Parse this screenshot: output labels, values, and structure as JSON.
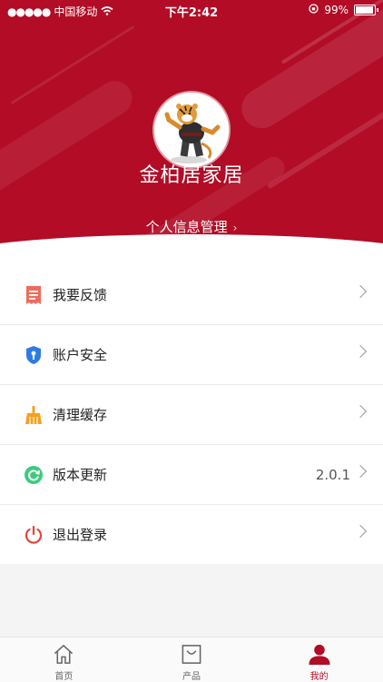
{
  "status_bar": {
    "carrier": "中国移动",
    "time": "下午2:42",
    "battery": "99%"
  },
  "profile": {
    "name": "金柏居家居",
    "info_link": "个人信息管理"
  },
  "menu": [
    {
      "label": "我要反馈",
      "value": "",
      "icon": "feedback-icon"
    },
    {
      "label": "账户安全",
      "value": "",
      "icon": "shield-lock-icon"
    },
    {
      "label": "清理缓存",
      "value": "",
      "icon": "broom-icon"
    },
    {
      "label": "版本更新",
      "value": "2.0.1",
      "icon": "refresh-icon"
    },
    {
      "label": "退出登录",
      "value": "",
      "icon": "power-icon"
    }
  ],
  "tabs": [
    {
      "label": "首页",
      "icon": "home-icon",
      "active": false
    },
    {
      "label": "产品",
      "icon": "shopping-bag-icon",
      "active": false
    },
    {
      "label": "我的",
      "icon": "user-icon",
      "active": true
    }
  ],
  "colors": {
    "brand": "#b20c26",
    "feedback": "#f06a5b",
    "security": "#2f7be5",
    "clean": "#f5a01c",
    "update": "#3ccb7f",
    "logout": "#e2453c"
  }
}
